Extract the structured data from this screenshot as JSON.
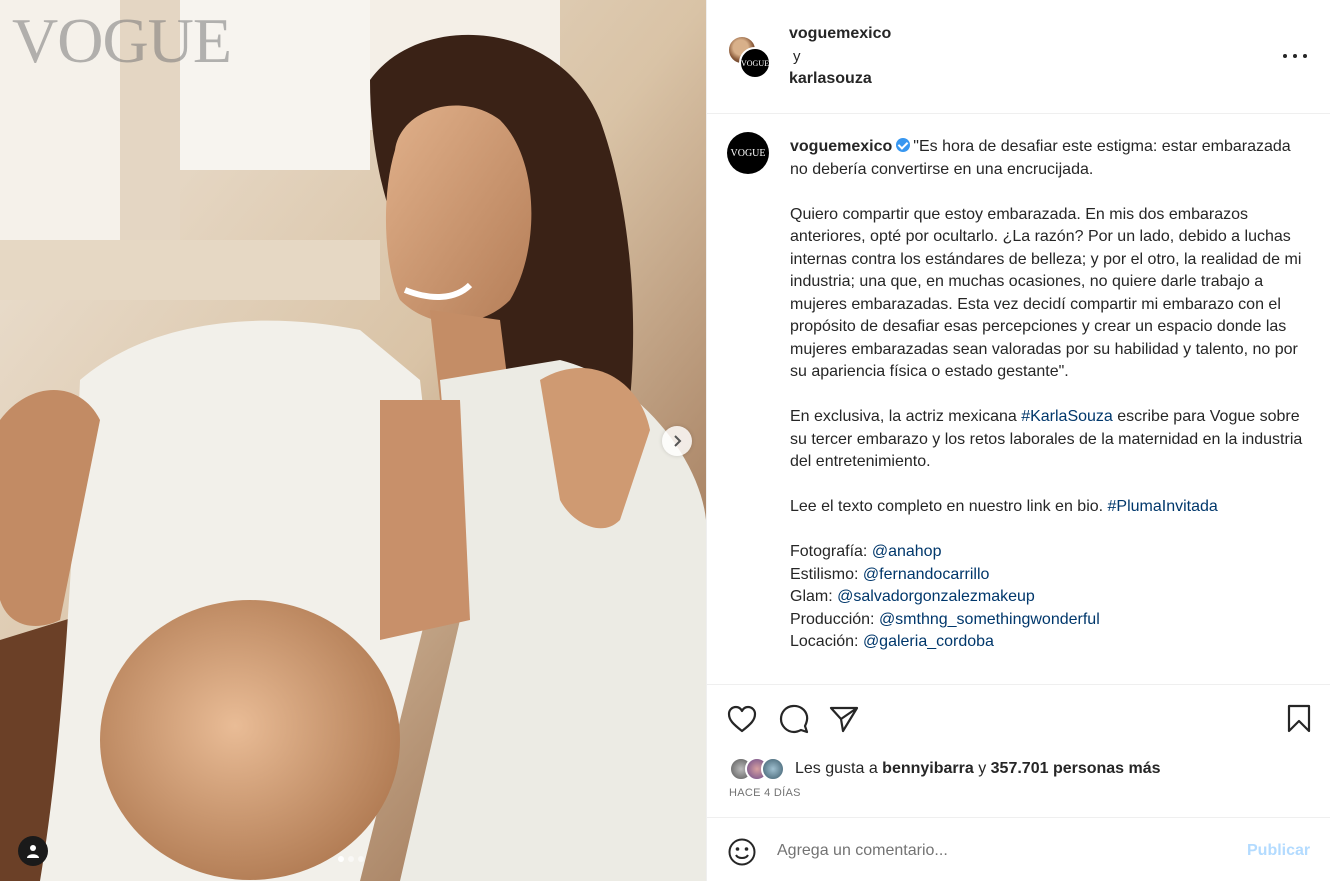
{
  "photo": {
    "watermark": "VOGUE",
    "carousel": {
      "total": 3,
      "active": 1
    }
  },
  "header": {
    "account1": "voguemexico",
    "conjunction": "y",
    "account2": "karlasouza"
  },
  "caption": {
    "username": "voguemexico",
    "para1": "\"Es hora de desafiar este estigma: estar embarazada no debería convertirse en una encrucijada.",
    "para2": "Quiero compartir que estoy embarazada. En mis dos embarazos anteriores, opté por ocultarlo. ¿La razón? Por un lado, debido a luchas internas contra los estándares de belleza; y por el otro, la realidad de mi industria; una que, en muchas ocasiones, no quiere darle trabajo a mujeres embarazadas. Esta vez decidí compartir mi embarazo con el propósito de desafiar esas percepciones y crear un espacio donde las mujeres embarazadas sean valoradas por su habilidad y talento, no por su apariencia física o estado gestante\".",
    "para3_before": "En exclusiva, la actriz mexicana ",
    "para3_tag": "#KarlaSouza",
    "para3_after": " escribe para Vogue sobre su tercer embarazo y los retos laborales de la maternidad en la industria del entretenimiento.",
    "para4_before": "Lee el texto completo en nuestro link en bio. ",
    "para4_tag": "#PlumaInvitada",
    "credits": [
      {
        "label": "Fotografía: ",
        "handle": "@anahop"
      },
      {
        "label": "Estilismo: ",
        "handle": "@fernandocarrillo"
      },
      {
        "label": "Glam: ",
        "handle": "@salvadorgonzalezmakeup"
      },
      {
        "label": "Producción: ",
        "handle": "@smthng_somethingwonderful"
      },
      {
        "label": "Locación: ",
        "handle": "@galeria_cordoba"
      }
    ]
  },
  "likes": {
    "prefix": "Les gusta a ",
    "user": "bennyibarra",
    "middle": " y ",
    "count": "357.701 personas más"
  },
  "timestamp": "HACE 4 DÍAS",
  "comment": {
    "placeholder": "Agrega un comentario...",
    "publish_label": "Publicar"
  }
}
